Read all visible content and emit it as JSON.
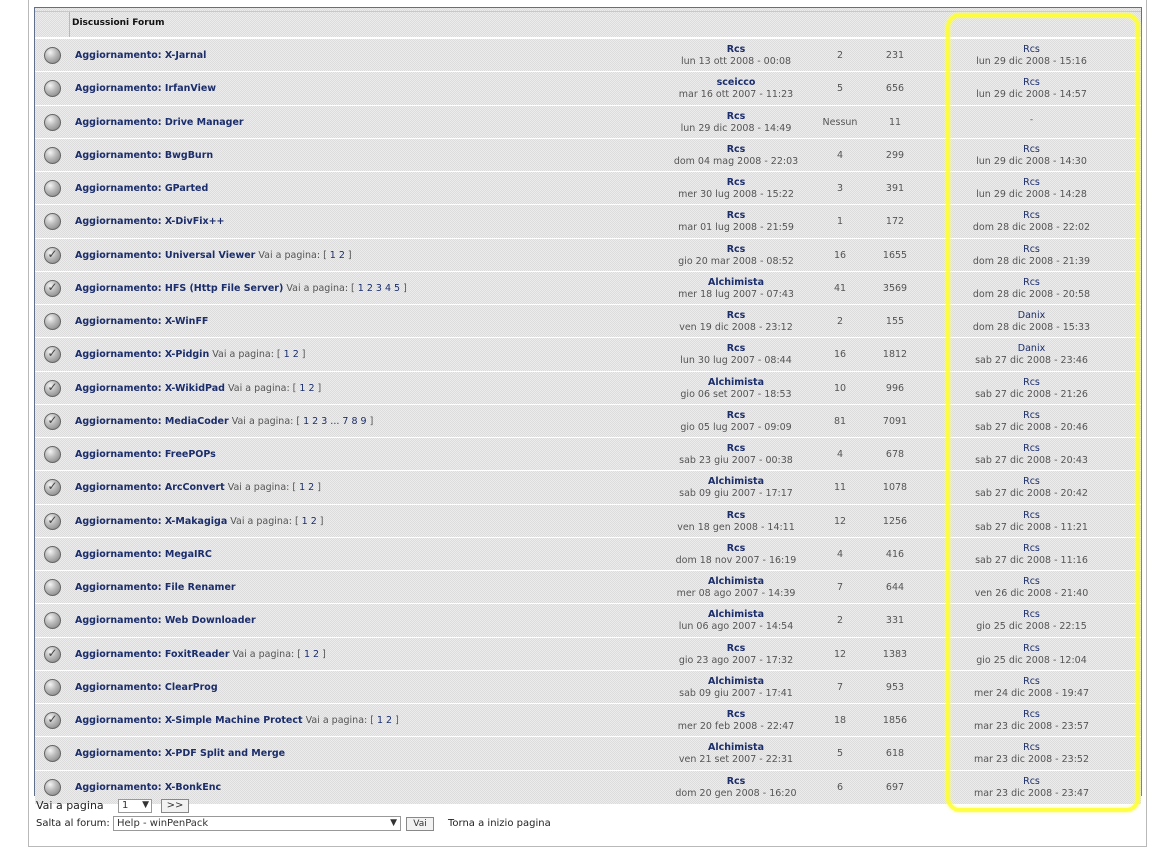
{
  "header": {
    "title": "Discussioni Forum"
  },
  "topics": [
    {
      "title": "Aggiornamento: X-Jarnal",
      "pages": null,
      "author": "Rcs",
      "author_date": "lun 13 ott 2008 - 00:08",
      "replies": "2",
      "views": "231",
      "last_user": "Rcs",
      "last_date": "lun 29 dic 2008 - 15:16",
      "icon": "topic-icon"
    },
    {
      "title": "Aggiornamento: IrfanView",
      "pages": null,
      "author": "sceicco",
      "author_date": "mar 16 ott 2007 - 11:23",
      "replies": "5",
      "views": "656",
      "last_user": "Rcs",
      "last_date": "lun 29 dic 2008 - 14:57",
      "icon": "topic-icon"
    },
    {
      "title": "Aggiornamento: Drive Manager",
      "pages": null,
      "author": "Rcs",
      "author_date": "lun 29 dic 2008 - 14:49",
      "replies": "Nessun",
      "views": "11",
      "last_user": "",
      "last_date": "-",
      "icon": "topic-icon"
    },
    {
      "title": "Aggiornamento: BwgBurn",
      "pages": null,
      "author": "Rcs",
      "author_date": "dom 04 mag 2008 - 22:03",
      "replies": "4",
      "views": "299",
      "last_user": "Rcs",
      "last_date": "lun 29 dic 2008 - 14:30",
      "icon": "topic-icon"
    },
    {
      "title": "Aggiornamento: GParted",
      "pages": null,
      "author": "Rcs",
      "author_date": "mer 30 lug 2008 - 15:22",
      "replies": "3",
      "views": "391",
      "last_user": "Rcs",
      "last_date": "lun 29 dic 2008 - 14:28",
      "icon": "topic-icon"
    },
    {
      "title": "Aggiornamento: X-DivFix++",
      "pages": null,
      "author": "Rcs",
      "author_date": "mar 01 lug 2008 - 21:59",
      "replies": "1",
      "views": "172",
      "last_user": "Rcs",
      "last_date": "dom 28 dic 2008 - 22:02",
      "icon": "topic-icon"
    },
    {
      "title": "Aggiornamento: Universal Viewer",
      "pages": "1 2",
      "author": "Rcs",
      "author_date": "gio 20 mar 2008 - 08:52",
      "replies": "16",
      "views": "1655",
      "last_user": "Rcs",
      "last_date": "dom 28 dic 2008 - 21:39",
      "icon": "hot-topic-icon"
    },
    {
      "title": "Aggiornamento: HFS (Http File Server)",
      "pages": "1 2 3 4 5",
      "author": "Alchimista",
      "author_date": "mer 18 lug 2007 - 07:43",
      "replies": "41",
      "views": "3569",
      "last_user": "Rcs",
      "last_date": "dom 28 dic 2008 - 20:58",
      "icon": "hot-topic-icon"
    },
    {
      "title": "Aggiornamento: X-WinFF",
      "pages": null,
      "author": "Rcs",
      "author_date": "ven 19 dic 2008 - 23:12",
      "replies": "2",
      "views": "155",
      "last_user": "Danix",
      "last_date": "dom 28 dic 2008 - 15:33",
      "icon": "topic-icon"
    },
    {
      "title": "Aggiornamento: X-Pidgin",
      "pages": "1 2",
      "author": "Rcs",
      "author_date": "lun 30 lug 2007 - 08:44",
      "replies": "16",
      "views": "1812",
      "last_user": "Danix",
      "last_date": "sab 27 dic 2008 - 23:46",
      "icon": "hot-topic-icon"
    },
    {
      "title": "Aggiornamento: X-WikidPad",
      "pages": "1 2",
      "author": "Alchimista",
      "author_date": "gio 06 set 2007 - 18:53",
      "replies": "10",
      "views": "996",
      "last_user": "Rcs",
      "last_date": "sab 27 dic 2008 - 21:26",
      "icon": "hot-topic-icon"
    },
    {
      "title": "Aggiornamento: MediaCoder",
      "pages": "1 2 3 ... 7 8 9",
      "author": "Rcs",
      "author_date": "gio 05 lug 2007 - 09:09",
      "replies": "81",
      "views": "7091",
      "last_user": "Rcs",
      "last_date": "sab 27 dic 2008 - 20:46",
      "icon": "hot-topic-icon"
    },
    {
      "title": "Aggiornamento: FreePOPs",
      "pages": null,
      "author": "Rcs",
      "author_date": "sab 23 giu 2007 - 00:38",
      "replies": "4",
      "views": "678",
      "last_user": "Rcs",
      "last_date": "sab 27 dic 2008 - 20:43",
      "icon": "topic-icon"
    },
    {
      "title": "Aggiornamento: ArcConvert",
      "pages": "1 2",
      "author": "Alchimista",
      "author_date": "sab 09 giu 2007 - 17:17",
      "replies": "11",
      "views": "1078",
      "last_user": "Rcs",
      "last_date": "sab 27 dic 2008 - 20:42",
      "icon": "hot-topic-icon"
    },
    {
      "title": "Aggiornamento: X-Makagiga",
      "pages": "1 2",
      "author": "Rcs",
      "author_date": "ven 18 gen 2008 - 14:11",
      "replies": "12",
      "views": "1256",
      "last_user": "Rcs",
      "last_date": "sab 27 dic 2008 - 11:21",
      "icon": "hot-topic-icon"
    },
    {
      "title": "Aggiornamento: MegaIRC",
      "pages": null,
      "author": "Rcs",
      "author_date": "dom 18 nov 2007 - 16:19",
      "replies": "4",
      "views": "416",
      "last_user": "Rcs",
      "last_date": "sab 27 dic 2008 - 11:16",
      "icon": "topic-icon"
    },
    {
      "title": "Aggiornamento: File Renamer",
      "pages": null,
      "author": "Alchimista",
      "author_date": "mer 08 ago 2007 - 14:39",
      "replies": "7",
      "views": "644",
      "last_user": "Rcs",
      "last_date": "ven 26 dic 2008 - 21:40",
      "icon": "topic-icon"
    },
    {
      "title": "Aggiornamento: Web Downloader",
      "pages": null,
      "author": "Alchimista",
      "author_date": "lun 06 ago 2007 - 14:54",
      "replies": "2",
      "views": "331",
      "last_user": "Rcs",
      "last_date": "gio 25 dic 2008 - 22:15",
      "icon": "topic-icon"
    },
    {
      "title": "Aggiornamento: FoxitReader",
      "pages": "1 2",
      "author": "Rcs",
      "author_date": "gio 23 ago 2007 - 17:32",
      "replies": "12",
      "views": "1383",
      "last_user": "Rcs",
      "last_date": "gio 25 dic 2008 - 12:04",
      "icon": "hot-topic-icon"
    },
    {
      "title": "Aggiornamento: ClearProg",
      "pages": null,
      "author": "Alchimista",
      "author_date": "sab 09 giu 2007 - 17:41",
      "replies": "7",
      "views": "953",
      "last_user": "Rcs",
      "last_date": "mer 24 dic 2008 - 19:47",
      "icon": "topic-icon"
    },
    {
      "title": "Aggiornamento: X-Simple Machine Protect",
      "pages": "1 2",
      "author": "Rcs",
      "author_date": "mer 20 feb 2008 - 22:47",
      "replies": "18",
      "views": "1856",
      "last_user": "Rcs",
      "last_date": "mar 23 dic 2008 - 23:57",
      "icon": "hot-topic-icon"
    },
    {
      "title": "Aggiornamento: X-PDF Split and Merge",
      "pages": null,
      "author": "Alchimista",
      "author_date": "ven 21 set 2007 - 22:31",
      "replies": "5",
      "views": "618",
      "last_user": "Rcs",
      "last_date": "mar 23 dic 2008 - 23:52",
      "icon": "topic-icon"
    },
    {
      "title": "Aggiornamento: X-BonkEnc",
      "pages": null,
      "author": "Rcs",
      "author_date": "dom 20 gen 2008 - 16:20",
      "replies": "6",
      "views": "697",
      "last_user": "Rcs",
      "last_date": "mar 23 dic 2008 - 23:47",
      "icon": "topic-icon"
    }
  ],
  "pages_label": "Vai a pagina:",
  "pager": {
    "label": "Vai a pagina",
    "selected": "1",
    "go": ">>"
  },
  "jump": {
    "label": "Salta al forum:",
    "selected": "Help - winPenPack",
    "go": "Vai"
  },
  "top_link": "Torna a inizio pagina",
  "colors": {
    "link": "#1b2d6b",
    "highlight": "#ffff33",
    "border": "#5f6f8c"
  }
}
